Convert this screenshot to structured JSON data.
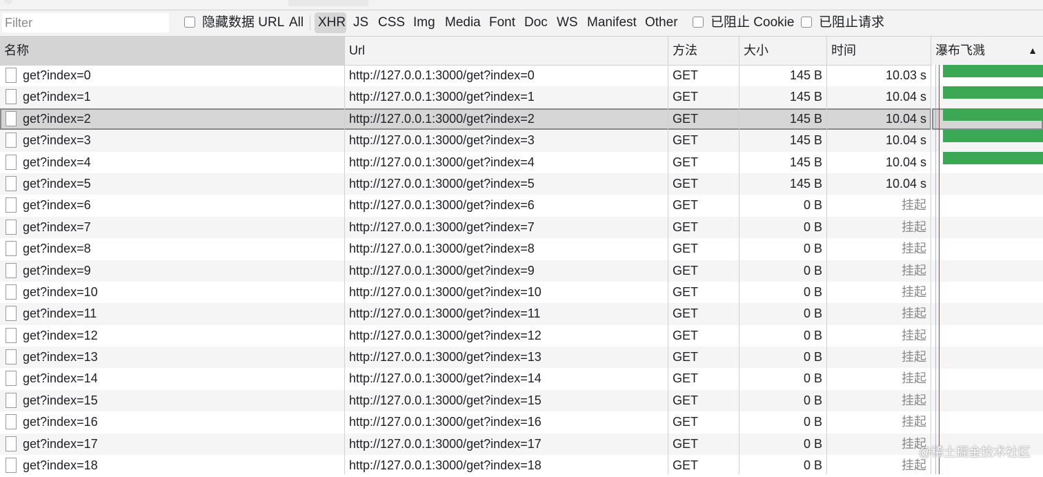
{
  "filter": {
    "placeholder": "Filter",
    "value": ""
  },
  "filter_options": {
    "hide_data_url": "隐藏数据 URL",
    "types": [
      "All",
      "XHR",
      "JS",
      "CSS",
      "Img",
      "Media",
      "Font",
      "Doc",
      "WS",
      "Manifest",
      "Other"
    ],
    "selected_type": "XHR",
    "blocked_cookies": "已阻止 Cookie",
    "blocked_requests": "已阻止请求"
  },
  "columns": {
    "name": "名称",
    "url": "Url",
    "method": "方法",
    "size": "大小",
    "time": "时间",
    "waterfall": "瀑布飞溅"
  },
  "sort_indicator": "▲",
  "colors": {
    "waterfall_bar": "#3ba855",
    "selected_row": "#d6d6d6",
    "timeline_marker": "#c0392b"
  },
  "requests": [
    {
      "name": "get?index=0",
      "url": "http://127.0.0.1:3000/get?index=0",
      "method": "GET",
      "size": "145 B",
      "time": "10.03 s",
      "selected": false,
      "bar": true
    },
    {
      "name": "get?index=1",
      "url": "http://127.0.0.1:3000/get?index=1",
      "method": "GET",
      "size": "145 B",
      "time": "10.04 s",
      "selected": false,
      "bar": true
    },
    {
      "name": "get?index=2",
      "url": "http://127.0.0.1:3000/get?index=2",
      "method": "GET",
      "size": "145 B",
      "time": "10.04 s",
      "selected": true,
      "bar": true
    },
    {
      "name": "get?index=3",
      "url": "http://127.0.0.1:3000/get?index=3",
      "method": "GET",
      "size": "145 B",
      "time": "10.04 s",
      "selected": false,
      "bar": true
    },
    {
      "name": "get?index=4",
      "url": "http://127.0.0.1:3000/get?index=4",
      "method": "GET",
      "size": "145 B",
      "time": "10.04 s",
      "selected": false,
      "bar": true
    },
    {
      "name": "get?index=5",
      "url": "http://127.0.0.1:3000/get?index=5",
      "method": "GET",
      "size": "145 B",
      "time": "10.04 s",
      "selected": false,
      "bar": false
    },
    {
      "name": "get?index=6",
      "url": "http://127.0.0.1:3000/get?index=6",
      "method": "GET",
      "size": "0 B",
      "time": "挂起",
      "selected": false,
      "bar": false
    },
    {
      "name": "get?index=7",
      "url": "http://127.0.0.1:3000/get?index=7",
      "method": "GET",
      "size": "0 B",
      "time": "挂起",
      "selected": false,
      "bar": false
    },
    {
      "name": "get?index=8",
      "url": "http://127.0.0.1:3000/get?index=8",
      "method": "GET",
      "size": "0 B",
      "time": "挂起",
      "selected": false,
      "bar": false
    },
    {
      "name": "get?index=9",
      "url": "http://127.0.0.1:3000/get?index=9",
      "method": "GET",
      "size": "0 B",
      "time": "挂起",
      "selected": false,
      "bar": false
    },
    {
      "name": "get?index=10",
      "url": "http://127.0.0.1:3000/get?index=10",
      "method": "GET",
      "size": "0 B",
      "time": "挂起",
      "selected": false,
      "bar": false
    },
    {
      "name": "get?index=11",
      "url": "http://127.0.0.1:3000/get?index=11",
      "method": "GET",
      "size": "0 B",
      "time": "挂起",
      "selected": false,
      "bar": false
    },
    {
      "name": "get?index=12",
      "url": "http://127.0.0.1:3000/get?index=12",
      "method": "GET",
      "size": "0 B",
      "time": "挂起",
      "selected": false,
      "bar": false
    },
    {
      "name": "get?index=13",
      "url": "http://127.0.0.1:3000/get?index=13",
      "method": "GET",
      "size": "0 B",
      "time": "挂起",
      "selected": false,
      "bar": false
    },
    {
      "name": "get?index=14",
      "url": "http://127.0.0.1:3000/get?index=14",
      "method": "GET",
      "size": "0 B",
      "time": "挂起",
      "selected": false,
      "bar": false
    },
    {
      "name": "get?index=15",
      "url": "http://127.0.0.1:3000/get?index=15",
      "method": "GET",
      "size": "0 B",
      "time": "挂起",
      "selected": false,
      "bar": false
    },
    {
      "name": "get?index=16",
      "url": "http://127.0.0.1:3000/get?index=16",
      "method": "GET",
      "size": "0 B",
      "time": "挂起",
      "selected": false,
      "bar": false
    },
    {
      "name": "get?index=17",
      "url": "http://127.0.0.1:3000/get?index=17",
      "method": "GET",
      "size": "0 B",
      "time": "挂起",
      "selected": false,
      "bar": false
    },
    {
      "name": "get?index=18",
      "url": "http://127.0.0.1:3000/get?index=18",
      "method": "GET",
      "size": "0 B",
      "time": "挂起",
      "selected": false,
      "bar": false
    }
  ],
  "watermark": "@稀土掘金技术社区"
}
